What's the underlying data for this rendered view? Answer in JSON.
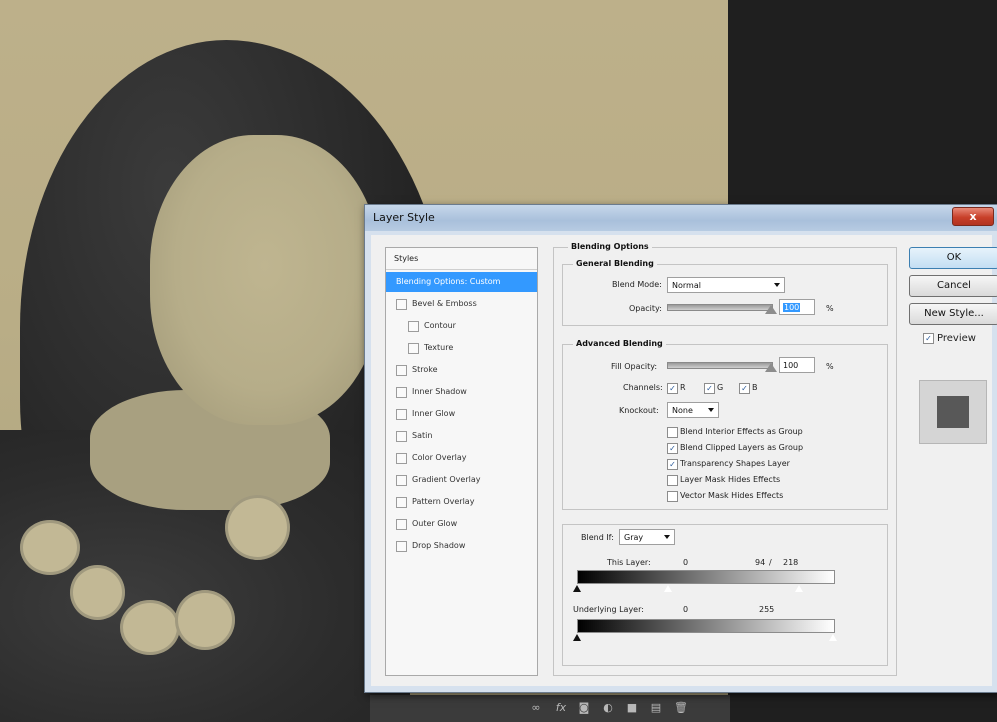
{
  "dialog": {
    "title": "Layer Style",
    "close_label": "x"
  },
  "styles_panel": {
    "header": "Styles",
    "items": [
      {
        "label": "Blending Options: Custom",
        "selected": true,
        "checkbox": false
      },
      {
        "label": "Bevel & Emboss",
        "selected": false,
        "checkbox": true
      },
      {
        "label": "Contour",
        "selected": false,
        "checkbox": true,
        "sub": true
      },
      {
        "label": "Texture",
        "selected": false,
        "checkbox": true,
        "sub": true
      },
      {
        "label": "Stroke",
        "selected": false,
        "checkbox": true
      },
      {
        "label": "Inner Shadow",
        "selected": false,
        "checkbox": true
      },
      {
        "label": "Inner Glow",
        "selected": false,
        "checkbox": true
      },
      {
        "label": "Satin",
        "selected": false,
        "checkbox": true
      },
      {
        "label": "Color Overlay",
        "selected": false,
        "checkbox": true
      },
      {
        "label": "Gradient Overlay",
        "selected": false,
        "checkbox": true
      },
      {
        "label": "Pattern Overlay",
        "selected": false,
        "checkbox": true
      },
      {
        "label": "Outer Glow",
        "selected": false,
        "checkbox": true
      },
      {
        "label": "Drop Shadow",
        "selected": false,
        "checkbox": true
      }
    ]
  },
  "blending_options": {
    "title": "Blending Options",
    "general": {
      "title": "General Blending",
      "blend_mode_label": "Blend Mode:",
      "blend_mode_value": "Normal",
      "opacity_label": "Opacity:",
      "opacity_value": "100",
      "opacity_unit": "%",
      "opacity_level": 1.0
    },
    "advanced": {
      "title": "Advanced Blending",
      "fill_opacity_label": "Fill Opacity:",
      "fill_opacity_value": "100",
      "fill_opacity_unit": "%",
      "fill_opacity_level": 1.0,
      "channels_label": "Channels:",
      "channels": [
        {
          "label": "R",
          "checked": true
        },
        {
          "label": "G",
          "checked": true
        },
        {
          "label": "B",
          "checked": true
        }
      ],
      "knockout_label": "Knockout:",
      "knockout_value": "None",
      "options": [
        {
          "label": "Blend Interior Effects as Group",
          "checked": false
        },
        {
          "label": "Blend Clipped Layers as Group",
          "checked": true
        },
        {
          "label": "Transparency Shapes Layer",
          "checked": true
        },
        {
          "label": "Layer Mask Hides Effects",
          "checked": false
        },
        {
          "label": "Vector Mask Hides Effects",
          "checked": false
        }
      ]
    },
    "blend_if": {
      "label": "Blend If:",
      "value": "Gray",
      "this_layer_label": "This Layer:",
      "this_layer_low": "0",
      "this_layer_high": "94",
      "this_layer_sep": "/",
      "this_layer_high2": "218",
      "underlying_label": "Underlying Layer:",
      "underlying_low": "0",
      "underlying_high": "255"
    }
  },
  "buttons": {
    "ok": "OK",
    "cancel": "Cancel",
    "new_style": "New Style...",
    "preview_label": "Preview",
    "preview_checked": true
  },
  "bottom_bar": {
    "icons": [
      "link-icon",
      "fx-icon",
      "mask-icon",
      "adjustment-icon",
      "folder-icon",
      "new-layer-icon",
      "trash-icon"
    ]
  }
}
